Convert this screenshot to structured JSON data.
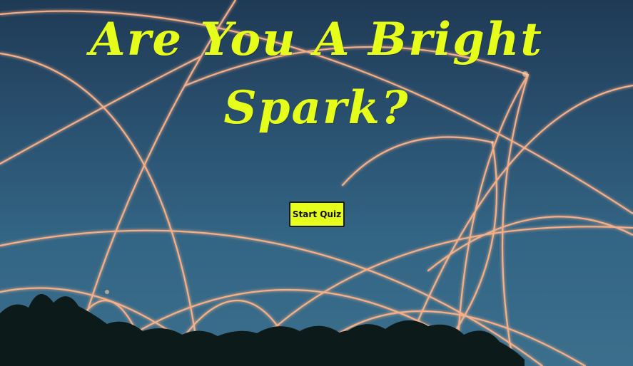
{
  "page": {
    "title": "Are You A Bright Spark?"
  },
  "quiz": {
    "start_label": "Start Quiz"
  },
  "background": {
    "description_icon": "sparkler-light-trails-image",
    "sky_color": "#2a5170",
    "trail_color": "#ffb48a"
  },
  "colors": {
    "accent": "#e6ff1a",
    "button_border": "#1a1a1a"
  }
}
